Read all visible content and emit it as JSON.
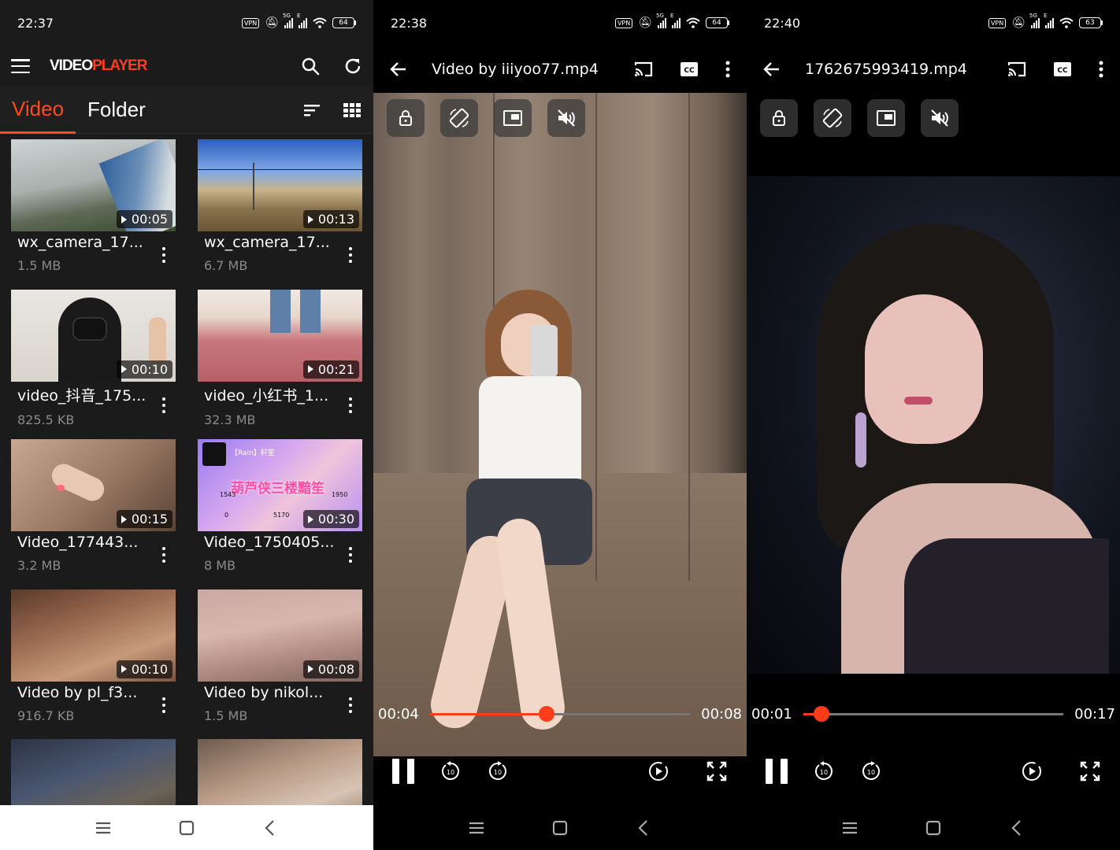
{
  "colors": {
    "accent": "#ff4a1c",
    "panel": "#1b1b1b",
    "muted": "#8a8a8a"
  },
  "library": {
    "status": {
      "time": "22:37",
      "vpn": "VPN",
      "net": "5G",
      "net2": "E",
      "battery": "64"
    },
    "app": {
      "logo_part1": "VIDEO",
      "logo_part2": "PLAYER",
      "icons": [
        "menu-icon",
        "search-icon",
        "refresh-icon",
        "sort-icon",
        "grid-view-icon"
      ]
    },
    "tabs": [
      {
        "label": "Video",
        "active": true
      },
      {
        "label": "Folder",
        "active": false
      }
    ],
    "videos": [
      {
        "name": "wx_camera_17...",
        "size": "1.5 MB",
        "duration": "00:05"
      },
      {
        "name": "wx_camera_17...",
        "size": "6.7 MB",
        "duration": "00:13"
      },
      {
        "name": "video_抖音_175...",
        "size": "825.5 KB",
        "duration": "00:10"
      },
      {
        "name": "video_小红书_1...",
        "size": "32.3 MB",
        "duration": "00:21"
      },
      {
        "name": "Video_177443...",
        "size": "3.2 MB",
        "duration": "00:15"
      },
      {
        "name": "Video_1750405...",
        "size": "8 MB",
        "duration": "00:30"
      },
      {
        "name": "Video by pl_f3...",
        "size": "916.7 KB",
        "duration": "00:10"
      },
      {
        "name": "Video by nikol...",
        "size": "1.5 MB",
        "duration": "00:08"
      },
      {
        "name": "",
        "size": "",
        "duration": ""
      },
      {
        "name": "",
        "size": "",
        "duration": ""
      }
    ],
    "thumb_text": {
      "name_tag": "【Rain】轩笙",
      "overlay_title": "葫芦侠三楼黯笙",
      "n1": "1950",
      "n2": "5170",
      "n3": "0",
      "n4": "1543"
    }
  },
  "player1": {
    "status": {
      "time": "22:38",
      "vpn": "VPN",
      "net": "5G",
      "net2": "E",
      "battery": "64"
    },
    "title": "Video by iiiyoo77.mp4",
    "elapsed": "00:04",
    "total": "00:08",
    "progress": 0.45
  },
  "player2": {
    "status": {
      "time": "22:40",
      "vpn": "VPN",
      "net": "5G",
      "net2": "E",
      "battery": "63"
    },
    "title": "1762675993419.mp4",
    "elapsed": "00:01",
    "total": "00:17",
    "progress": 0.07
  }
}
